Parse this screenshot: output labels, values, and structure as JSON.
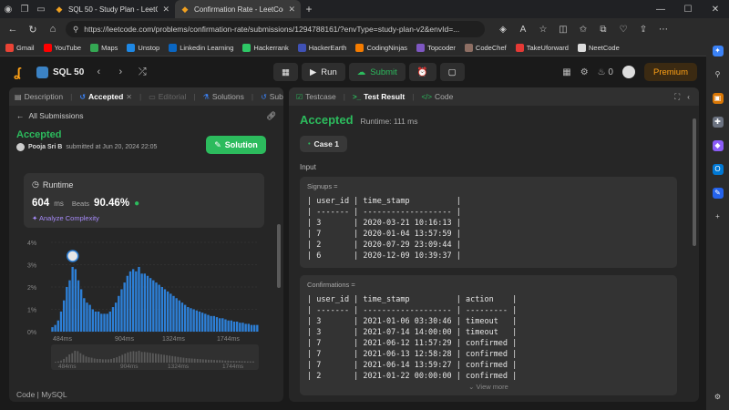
{
  "browser": {
    "tabs": [
      {
        "title": "SQL 50 - Study Plan - LeetCode",
        "active": false
      },
      {
        "title": "Confirmation Rate - LeetCode",
        "active": true
      }
    ],
    "url": "https://leetcode.com/problems/confirmation-rate/submissions/1294788161/?envType=study-plan-v2&envId=...",
    "bookmarks": [
      {
        "label": "Gmail",
        "color": "#ea4335"
      },
      {
        "label": "YouTube",
        "color": "#ff0000"
      },
      {
        "label": "Maps",
        "color": "#34a853"
      },
      {
        "label": "Unstop",
        "color": "#1e88e5"
      },
      {
        "label": "Linkedin Learning",
        "color": "#0a66c2"
      },
      {
        "label": "Hackerrank",
        "color": "#2ec866"
      },
      {
        "label": "HackerEarth",
        "color": "#3f51b5"
      },
      {
        "label": "CodingNinjas",
        "color": "#f57c00"
      },
      {
        "label": "Topcoder",
        "color": "#7e57c2"
      },
      {
        "label": "CodeChef",
        "color": "#8d6e63"
      },
      {
        "label": "TakeUforward",
        "color": "#e53935"
      },
      {
        "label": "NeetCode",
        "color": "#dddddd"
      }
    ]
  },
  "header": {
    "set_name": "SQL 50",
    "run_label": "Run",
    "submit_label": "Submit",
    "streak": "0",
    "premium_label": "Premium"
  },
  "left_panel": {
    "tabs": [
      {
        "label": "Description",
        "active": false
      },
      {
        "label": "Accepted",
        "active": true
      },
      {
        "label": "Editorial",
        "active": false
      },
      {
        "label": "Solutions",
        "active": false
      },
      {
        "label": "Subm",
        "active": false
      }
    ],
    "back_label": "All Submissions",
    "status": "Accepted",
    "user": "Pooja Sri B",
    "submitted_text": "submitted at Jun 20, 2024 22:05",
    "solution_button": "Solution",
    "runtime_title": "Runtime",
    "runtime_value": "604",
    "runtime_unit": "ms",
    "beats_label": "Beats",
    "beats_pct": "90.46%",
    "analyze_label": "Analyze Complexity",
    "code_lang": "Code | MySQL"
  },
  "chart_data": {
    "type": "bar",
    "y_ticks": [
      "4%",
      "3%",
      "2%",
      "1%",
      "0%"
    ],
    "x_ticks": [
      "484ms",
      "904ms",
      "1324ms",
      "1744ms"
    ],
    "ylim": [
      0,
      4
    ],
    "highlight_ms": 604,
    "values": [
      0.2,
      0.3,
      0.5,
      0.9,
      1.4,
      2.0,
      2.3,
      2.9,
      2.8,
      2.3,
      1.9,
      1.5,
      1.3,
      1.2,
      1.0,
      0.9,
      0.9,
      0.8,
      0.8,
      0.8,
      0.9,
      1.1,
      1.3,
      1.6,
      1.9,
      2.2,
      2.5,
      2.7,
      2.8,
      2.7,
      2.9,
      2.6,
      2.6,
      2.5,
      2.4,
      2.3,
      2.2,
      2.1,
      2.0,
      1.9,
      1.8,
      1.7,
      1.6,
      1.5,
      1.4,
      1.3,
      1.2,
      1.1,
      1.05,
      1.0,
      0.95,
      0.9,
      0.85,
      0.8,
      0.75,
      0.7,
      0.7,
      0.65,
      0.6,
      0.6,
      0.55,
      0.5,
      0.5,
      0.45,
      0.45,
      0.4,
      0.4,
      0.35,
      0.35,
      0.3,
      0.3,
      0.3
    ]
  },
  "right_panel": {
    "tabs": [
      {
        "label": "Testcase",
        "active": false
      },
      {
        "label": "Test Result",
        "active": true
      },
      {
        "label": "Code",
        "active": false
      }
    ],
    "status": "Accepted",
    "runtime_text": "Runtime: 111 ms",
    "case_label": "Case 1",
    "input_label": "Input",
    "signups": {
      "name": "Signups =",
      "text": "| user_id | time_stamp          |\n| ------- | ------------------- |\n| 3       | 2020-03-21 10:16:13 |\n| 7       | 2020-01-04 13:57:59 |\n| 2       | 2020-07-29 23:09:44 |\n| 6       | 2020-12-09 10:39:37 |"
    },
    "confirmations": {
      "name": "Confirmations =",
      "text": "| user_id | time_stamp          | action    |\n| ------- | ------------------- | --------- |\n| 3       | 2021-01-06 03:30:46 | timeout   |\n| 3       | 2021-07-14 14:00:00 | timeout   |\n| 7       | 2021-06-12 11:57:29 | confirmed |\n| 7       | 2021-06-13 12:58:28 | confirmed |\n| 7       | 2021-06-14 13:59:27 | confirmed |\n| 2       | 2021-01-22 00:00:00 | confirmed |"
    },
    "view_more": "View more"
  }
}
